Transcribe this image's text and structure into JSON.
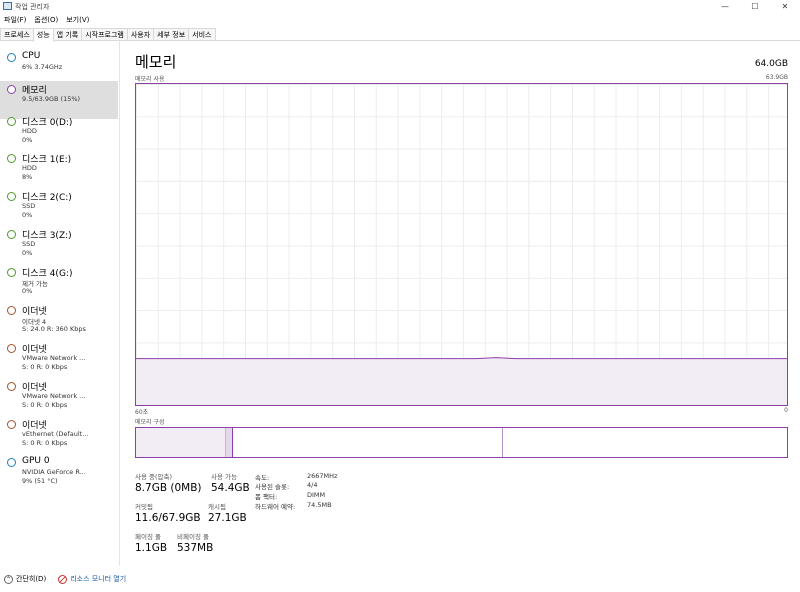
{
  "window": {
    "title": "작업 관리자",
    "minimize": "—",
    "maximize": "☐",
    "close": "✕"
  },
  "menu": [
    "파일(F)",
    "옵션(O)",
    "보기(V)"
  ],
  "tabs": [
    "프로세스",
    "성능",
    "앱 기록",
    "시작프로그램",
    "사용자",
    "세부 정보",
    "서비스"
  ],
  "active_tab": "성능",
  "sidebar": [
    {
      "name": "CPU",
      "lines": [
        "6% 3.74GHz"
      ],
      "color": "#1c7fc0"
    },
    {
      "name": "메모리",
      "lines": [
        "9.5/63.9GB (15%)"
      ],
      "color": "#8b3fa8",
      "selected": true
    },
    {
      "name": "디스크 0(D:)",
      "lines": [
        "HDD",
        "0%"
      ],
      "color": "#4d9a2a"
    },
    {
      "name": "디스크 1(E:)",
      "lines": [
        "HDD",
        "8%"
      ],
      "color": "#4d9a2a"
    },
    {
      "name": "디스크 2(C:)",
      "lines": [
        "SSD",
        "0%"
      ],
      "color": "#4d9a2a"
    },
    {
      "name": "디스크 3(Z:)",
      "lines": [
        "SSD",
        "0%"
      ],
      "color": "#4d9a2a"
    },
    {
      "name": "디스크 4(G:)",
      "lines": [
        "제거 가능",
        "0%"
      ],
      "color": "#4d9a2a"
    },
    {
      "name": "이더넷",
      "lines": [
        "이더넷 4",
        "S: 24.0  R: 360 Kbps"
      ],
      "color": "#a7522c"
    },
    {
      "name": "이더넷",
      "lines": [
        "VMware Network ...",
        "S: 0  R: 0 Kbps"
      ],
      "color": "#a7522c"
    },
    {
      "name": "이더넷",
      "lines": [
        "VMware Network ...",
        "S: 0  R: 0 Kbps"
      ],
      "color": "#a7522c"
    },
    {
      "name": "이더넷",
      "lines": [
        "vEthernet (Default...",
        "S: 0  R: 0 Kbps"
      ],
      "color": "#a7522c"
    },
    {
      "name": "GPU 0",
      "lines": [
        "NVIDIA GeForce R...",
        "9% (51 °C)"
      ],
      "color": "#1c7fc0"
    }
  ],
  "main": {
    "title": "메모리",
    "total": "64.0GB",
    "usage_label": "메모리 사용",
    "usage_max": "63.9GB",
    "time_left": "60초",
    "time_right": "0",
    "composition_label": "메모리 구성",
    "usage_fraction": 0.15
  },
  "stats": {
    "in_use_label": "사용 중(압축)",
    "in_use_value": "8.7GB (0MB)",
    "available_label": "사용 가능",
    "available_value": "54.4GB",
    "committed_label": "커밋됨",
    "committed_value": "11.6/67.9GB",
    "cached_label": "캐시됨",
    "cached_value": "27.1GB",
    "paged_label": "페이징 풀",
    "paged_value": "1.1GB",
    "nonpaged_label": "비페이징 풀",
    "nonpaged_value": "537MB"
  },
  "props": {
    "speed_label": "속도:",
    "speed_value": "2667MHz",
    "slots_label": "사용된 슬롯:",
    "slots_value": "4/4",
    "form_label": "폼 팩터:",
    "form_value": "DIMM",
    "reserved_label": "하드웨어 예약:",
    "reserved_value": "74.5MB"
  },
  "bottom": {
    "fewer": "간단히(D)",
    "monitor": "리소스 모니터 열기"
  }
}
